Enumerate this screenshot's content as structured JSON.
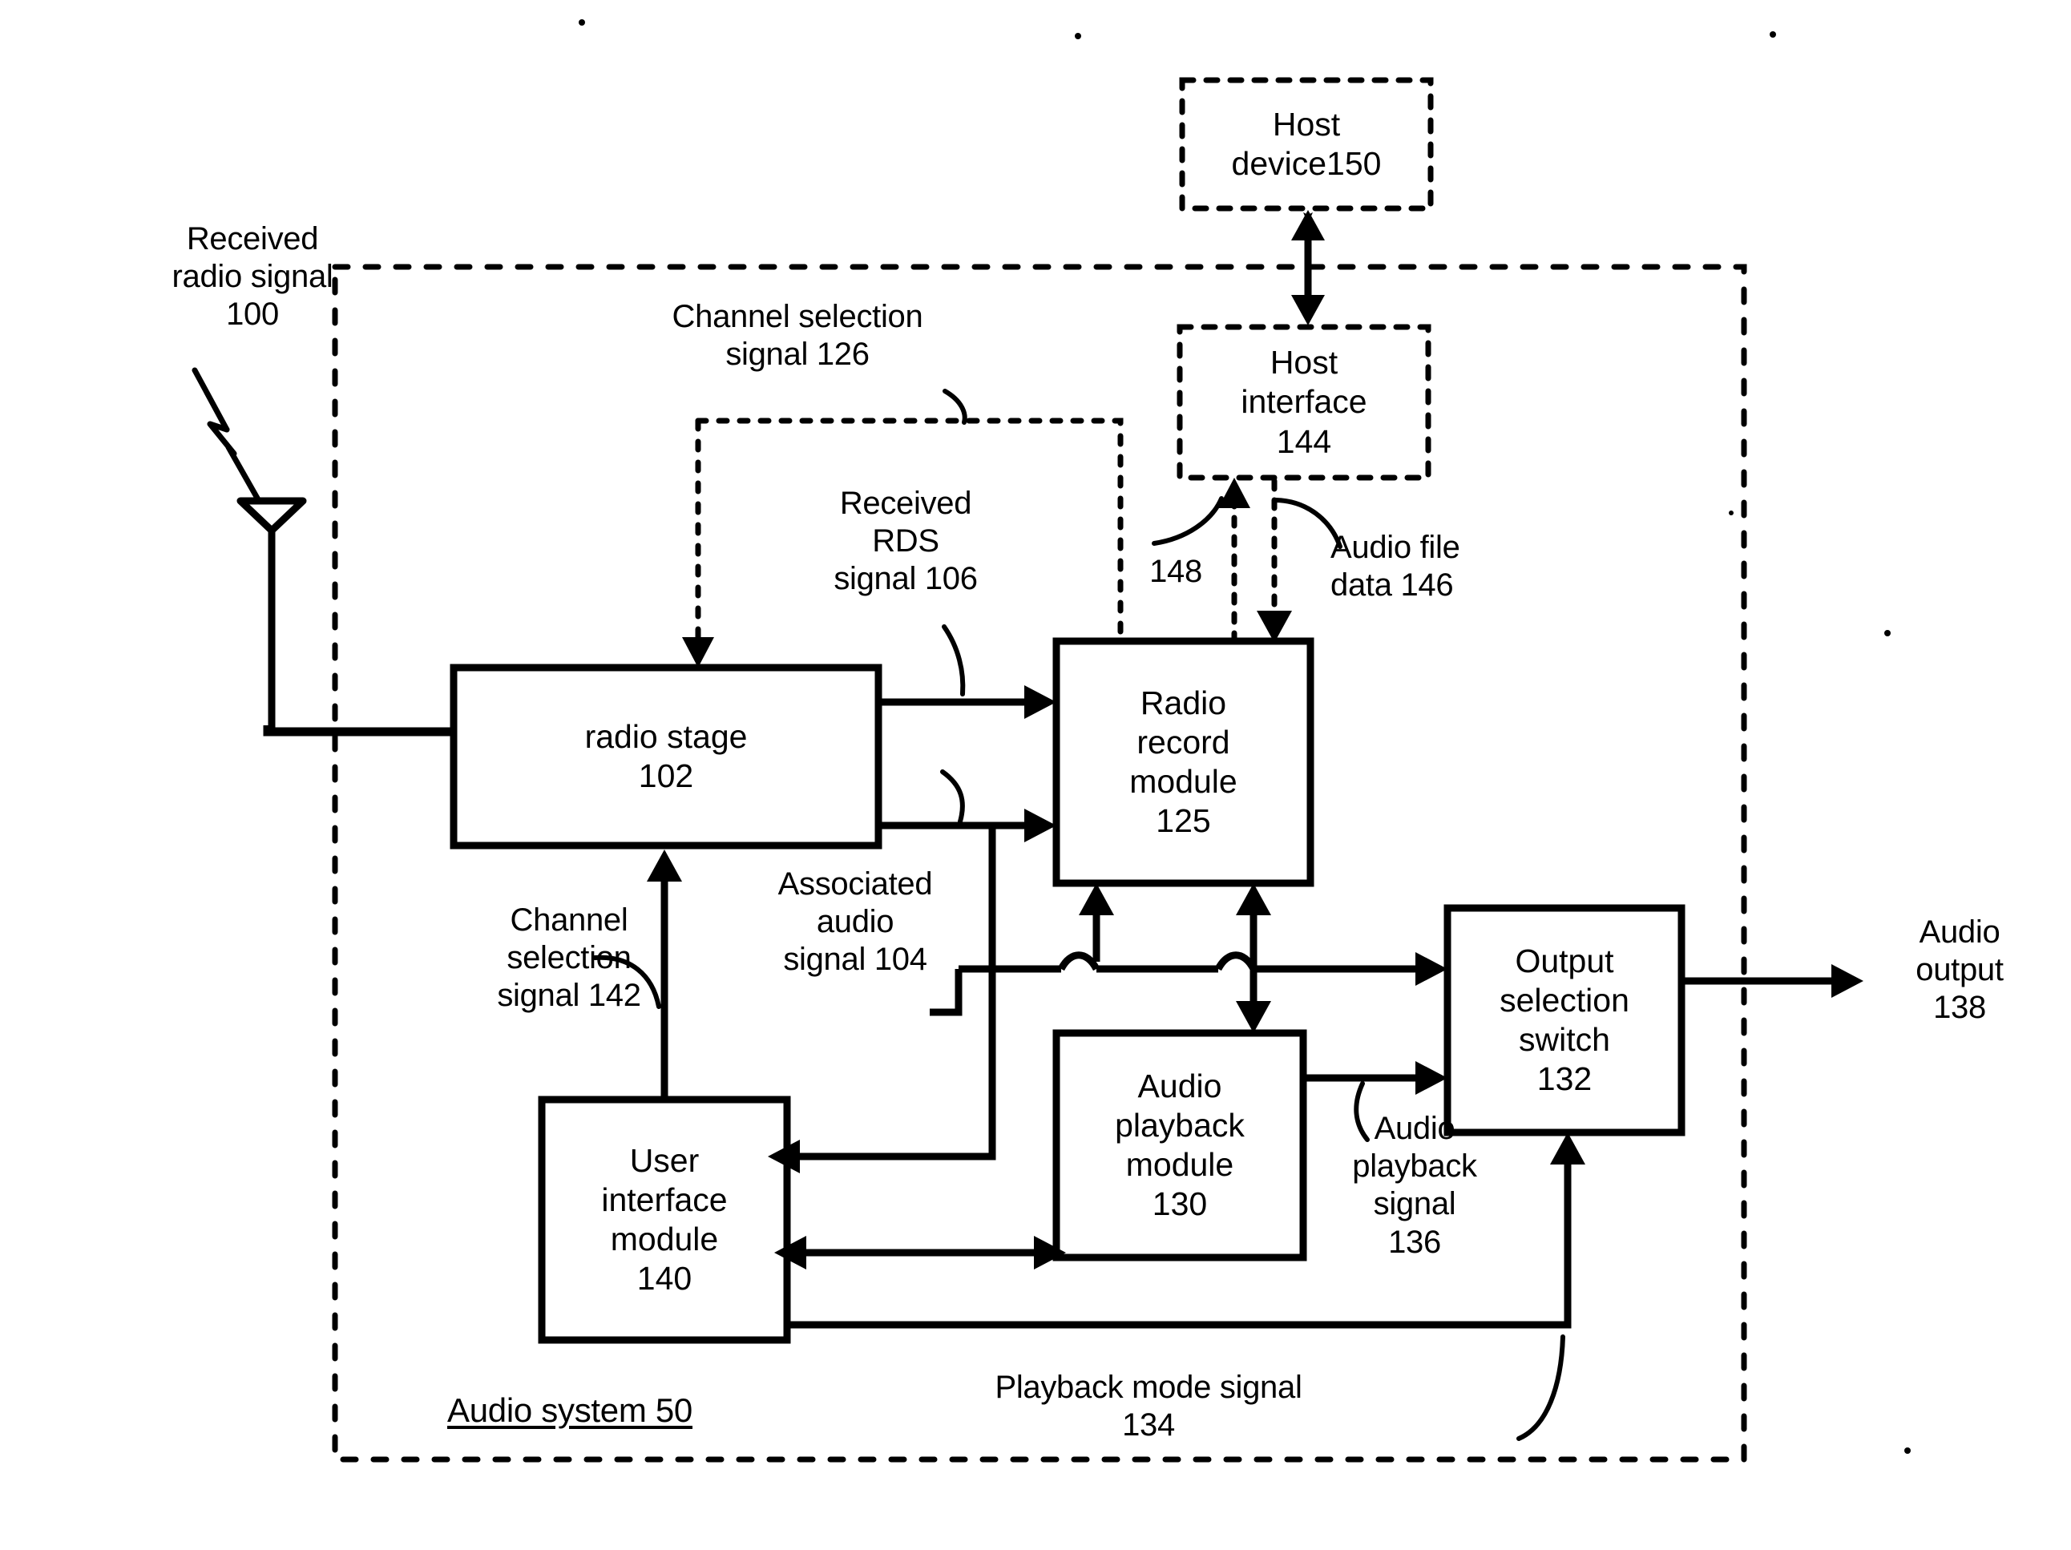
{
  "figure": {
    "title": "Audio system block diagram",
    "outer_boundary_label": "Audio system 50"
  },
  "blocks": {
    "host_device": "Host\ndevice150",
    "host_interface": "Host\ninterface\n144",
    "radio_stage": "radio stage\n102",
    "radio_record_module": "Radio\nrecord\nmodule\n125",
    "output_selection_switch": "Output\nselection\nswitch\n132",
    "audio_playback_module": "Audio\nplayback\nmodule\n130",
    "user_interface_module": "User\ninterface\nmodule\n140"
  },
  "signal_labels": {
    "received_radio_signal": "Received\nradio signal\n100",
    "channel_selection_signal_126": "Channel selection\nsignal 126",
    "received_rds_signal": "Received\nRDS\nsignal 106",
    "ref_148": "148",
    "audio_file_data": "Audio file\ndata 146",
    "associated_audio_signal": "Associated\naudio\nsignal 104",
    "channel_selection_signal_142": "Channel\nselection\nsignal 142",
    "audio_playback_signal": "Audio\nplayback\nsignal\n136",
    "audio_output": "Audio\noutput\n138",
    "playback_mode_signal": "Playback mode signal\n134"
  },
  "icons": {
    "antenna": "antenna-icon",
    "lightning": "lightning-bolt-icon"
  },
  "colors": {
    "stroke": "#000000",
    "background": "#ffffff"
  }
}
